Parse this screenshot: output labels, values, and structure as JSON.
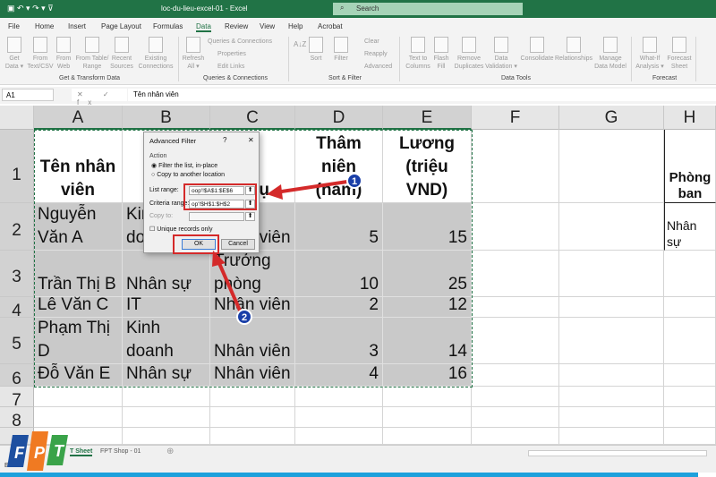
{
  "window": {
    "title": "loc-du-lieu-excel-01  -  Excel",
    "search_placeholder": "Search"
  },
  "menu": [
    "File",
    "Home",
    "Insert",
    "Page Layout",
    "Formulas",
    "Data",
    "Review",
    "View",
    "Help",
    "Acrobat"
  ],
  "ribbon": {
    "buttons": [
      {
        "label": "Get Data ▾",
        "icon": "database-icon"
      },
      {
        "label": "From Text/CSV",
        "icon": "text-file-icon"
      },
      {
        "label": "From Web",
        "icon": "web-icon"
      },
      {
        "label": "From Table/ Range",
        "icon": "table-icon"
      },
      {
        "label": "Recent Sources",
        "icon": "recent-icon"
      },
      {
        "label": "Existing Connections",
        "icon": "connections-icon"
      },
      {
        "label": "Refresh All ▾",
        "icon": "refresh-icon"
      },
      {
        "label": "Sort",
        "icon": "sort-icon"
      },
      {
        "label": "Filter",
        "icon": "filter-icon"
      },
      {
        "label": "Text to Columns",
        "icon": "text-columns-icon"
      },
      {
        "label": "Flash Fill",
        "icon": "flash-fill-icon"
      },
      {
        "label": "Remove Duplicates",
        "icon": "remove-duplicates-icon"
      },
      {
        "label": "Data Validation ▾",
        "icon": "validation-icon"
      },
      {
        "label": "Consolidate",
        "icon": "consolidate-icon"
      },
      {
        "label": "Relationships",
        "icon": "relationships-icon"
      },
      {
        "label": "Manage Data Model",
        "icon": "data-model-icon"
      },
      {
        "label": "What-If Analysis ▾",
        "icon": "what-if-icon"
      },
      {
        "label": "Forecast Sheet",
        "icon": "forecast-icon"
      }
    ],
    "small": {
      "queries": "Queries & Connections",
      "properties": "Properties",
      "edit_links": "Edit Links",
      "clear": "Clear",
      "reapply": "Reapply",
      "advanced": "Advanced"
    },
    "groups": [
      "Get & Transform Data",
      "Queries & Connections",
      "Sort & Filter",
      "Data Tools",
      "Forecast"
    ]
  },
  "formula_bar": {
    "name_box": "A1",
    "fx": "✕ ✓ fx",
    "value": "Tên nhân viên"
  },
  "columns": [
    "A",
    "B",
    "C",
    "D",
    "E",
    "F",
    "G",
    "H"
  ],
  "rows": [
    "1",
    "2",
    "3",
    "4",
    "5",
    "6",
    "7",
    "8"
  ],
  "cells": {
    "A1": "Tên nhân viên",
    "C1": "c vụ",
    "D1": "Thâm niên (năm)",
    "E1": "Lương (triệu VND)",
    "H1": "Phòng ban",
    "A2": "Nguyễn Văn A",
    "B2": "Kinh doanh",
    "C2": "Nhân viên",
    "D2": "5",
    "E2": "15",
    "H2": "Nhân sự",
    "A3": "Trần Thị B",
    "B3": "Nhân sự",
    "C3": "Trưởng phòng",
    "D3": "10",
    "E3": "25",
    "A4": "Lê Văn C",
    "B4": "IT",
    "C4": "Nhân viên",
    "D4": "2",
    "E4": "12",
    "A5": "Phạm Thị D",
    "B5": "Kinh doanh",
    "C5": "Nhân viên",
    "D5": "3",
    "E5": "14",
    "A6": "Đỗ Văn E",
    "B6": "Nhân sự",
    "C6": "Nhân viên",
    "D6": "4",
    "E6": "16"
  },
  "dialog": {
    "title": "Advanced Filter",
    "help": "?",
    "close": "✕",
    "action": "Action",
    "opt1": "Filter the list, in-place",
    "opt2": "Copy to another location",
    "list_label": "List range:",
    "list_value": "oop'!$A$1:$E$6",
    "crit_label": "Criteria range:",
    "crit_value": "op'!$H$1:$H$2",
    "copy_label": "Copy to:",
    "unique": "Unique records only",
    "ok": "OK",
    "cancel": "Cancel"
  },
  "annotations": {
    "badge1": "1",
    "badge2": "2",
    "annotation_color": "#d42a2a"
  },
  "sheet_tabs": [
    "T Sheet",
    "FPT Shop - 01"
  ],
  "status": "Enter",
  "logo": "FPT"
}
